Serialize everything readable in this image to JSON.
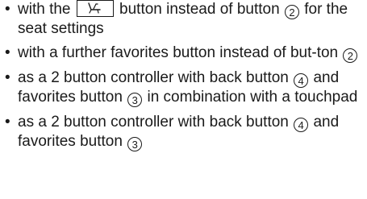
{
  "items": [
    {
      "pre": "with the",
      "icon": "seat-settings-icon",
      "mid": "button instead of button",
      "num": "2",
      "post": "for the seat settings"
    },
    {
      "pre": "with a further favorites button instead of but-ton",
      "num": "2"
    },
    {
      "pre": "as a 2 button controller with back button",
      "num1": "4",
      "mid": "and favorites button",
      "num2": "3",
      "post": "in combination with a touchpad"
    },
    {
      "pre": "as a 2 button controller with back button",
      "num1": "4",
      "mid": "and favorites button",
      "num2": "3"
    }
  ]
}
